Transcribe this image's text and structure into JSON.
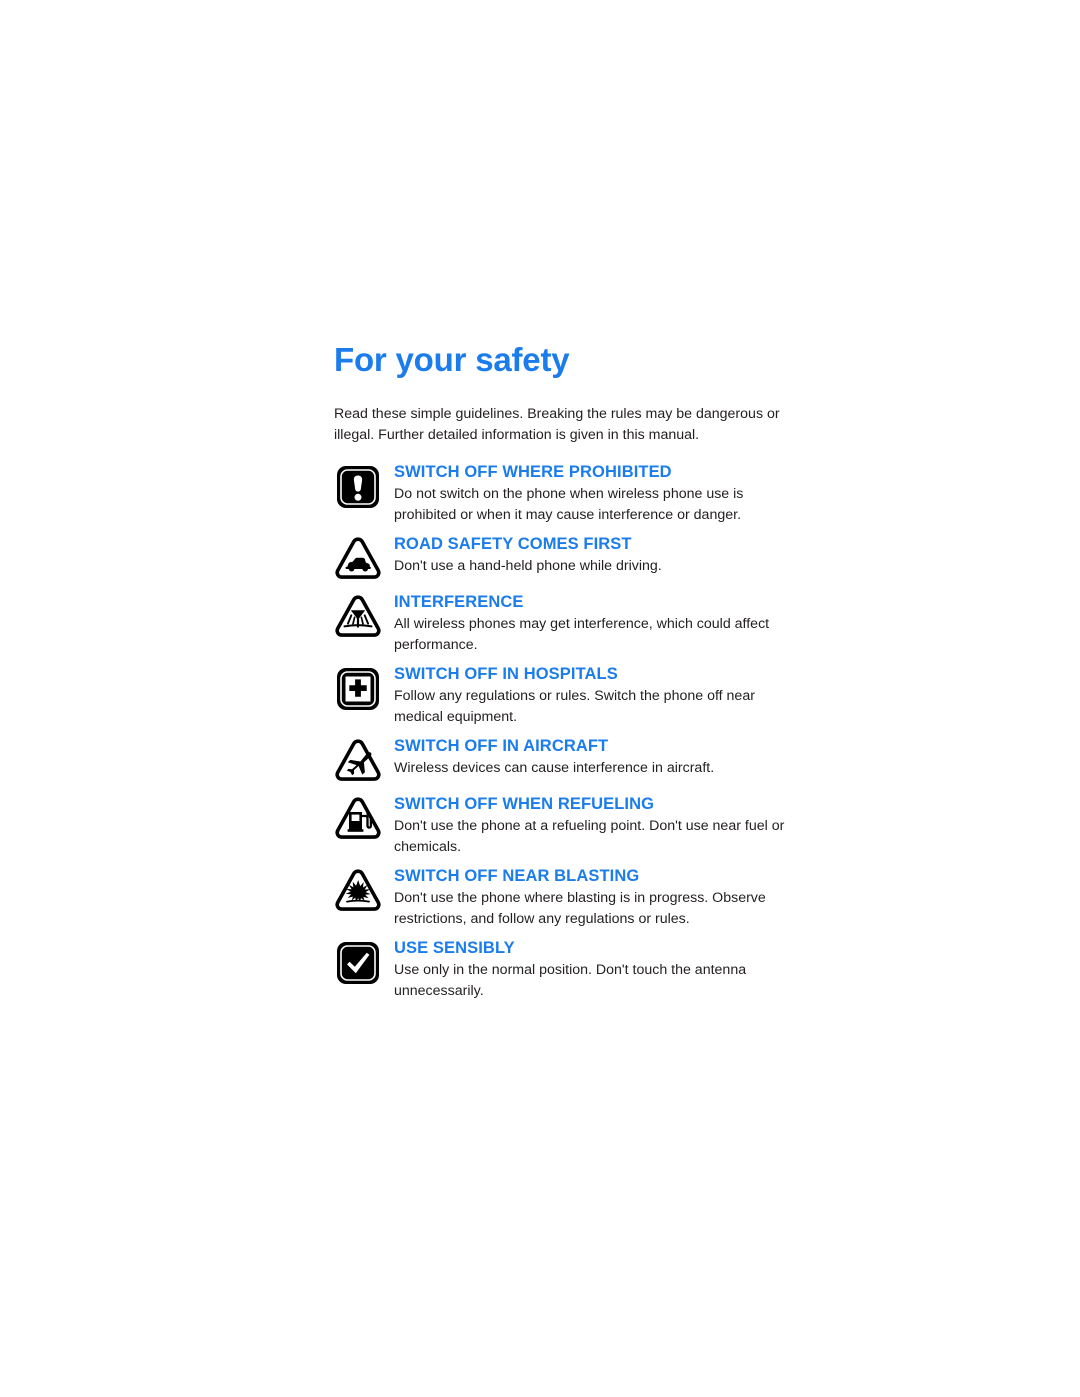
{
  "document": {
    "title": "For your safety",
    "intro": "Read these simple guidelines. Breaking the rules may be dangerous or illegal. Further detailed information is given in this manual.",
    "accent_color": "#1b7ceb",
    "text_color": "#231f20",
    "background_color": "#ffffff",
    "items": [
      {
        "icon": "exclamation-square-icon",
        "heading": "SWITCH OFF WHERE PROHIBITED",
        "body": "Do not switch on the phone when wireless phone use is prohibited or when it may cause interference or danger."
      },
      {
        "icon": "car-triangle-icon",
        "heading": "ROAD SAFETY COMES FIRST",
        "body": "Don't use a hand-held phone while driving."
      },
      {
        "icon": "interference-antenna-triangle-icon",
        "heading": "INTERFERENCE",
        "body": "All wireless phones may get interference, which could affect performance."
      },
      {
        "icon": "hospital-cross-square-icon",
        "heading": "SWITCH OFF IN HOSPITALS",
        "body": "Follow any regulations or rules. Switch the phone off near medical equipment."
      },
      {
        "icon": "airplane-triangle-icon",
        "heading": "SWITCH OFF IN AIRCRAFT",
        "body": "Wireless devices can cause interference in aircraft."
      },
      {
        "icon": "fuel-pump-triangle-icon",
        "heading": "SWITCH OFF WHEN REFUELING",
        "body": "Don't use the phone at a refueling point. Don't use near fuel or chemicals."
      },
      {
        "icon": "explosion-triangle-icon",
        "heading": "SWITCH OFF NEAR BLASTING",
        "body": "Don't use the phone where blasting is in progress. Observe restrictions, and follow any regulations or rules."
      },
      {
        "icon": "checkmark-square-icon",
        "heading": "USE SENSIBLY",
        "body": "Use only in the normal position. Don't touch the antenna unnecessarily."
      }
    ]
  }
}
